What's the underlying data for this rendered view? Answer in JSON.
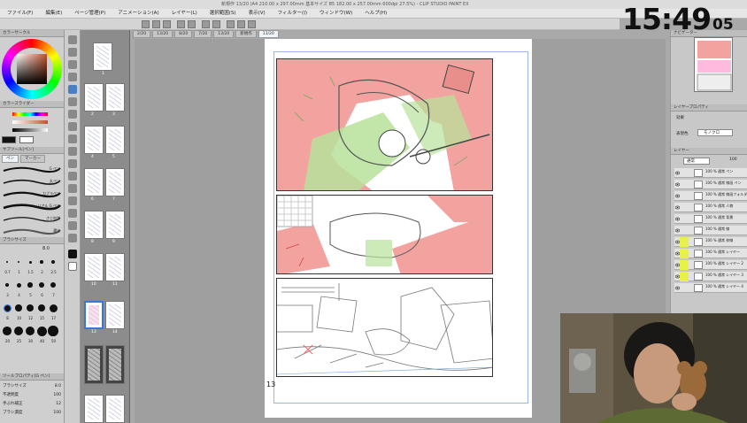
{
  "title_bar": {
    "text": "新規作 13/20 (A4 210.00 x 297.00mm 基本サイズ B5 182.00 x 257.00mm 600dpi 27.5%) - CLIP STUDIO PAINT EX"
  },
  "menu": [
    "ファイル(F)",
    "編集(E)",
    "ページ管理(P)",
    "アニメーション(A)",
    "レイヤー(L)",
    "選択範囲(S)",
    "表示(V)",
    "フィルター(I)",
    "ウィンドウ(W)",
    "ヘルプ(H)"
  ],
  "doc_tabs": [
    "2/20",
    "13/20",
    "8/20",
    "7/20",
    "13/20",
    "新規作",
    "13/20"
  ],
  "left_panel": {
    "color_header": "カラーサークル",
    "slider_header": "カラースライダー",
    "brush_header": "サブツール[ペン]",
    "brush_tab": "ペン",
    "brush_tab2": "マーカー",
    "brushes": [
      "G ペン",
      "丸ペン",
      "カブラペン",
      "リアル G ペン",
      "さじ加減",
      "濃淡"
    ],
    "size_header": "ブラシサイズ",
    "size_value": "8.0",
    "size_labels": [
      "0.7",
      "1",
      "1.5",
      "2",
      "2.5",
      "3",
      "4",
      "5",
      "6",
      "7",
      "8",
      "10",
      "12",
      "15",
      "17",
      "20",
      "25",
      "30",
      "40",
      "50"
    ],
    "tool_prop_header": "ツールプロパティ[G ペン]",
    "props": [
      "ブラシサイズ",
      "不透明度",
      "手ぶれ補正",
      "ブラシ濃度"
    ],
    "prop_values": [
      "8.0",
      "100",
      "12",
      "100"
    ]
  },
  "page_panel": {
    "pages": [
      "1",
      "2",
      "3",
      "4",
      "5",
      "6",
      "7",
      "8",
      "9",
      "10",
      "11",
      "12",
      "13",
      "14"
    ],
    "active": "13"
  },
  "canvas": {
    "page_number": "13"
  },
  "right_panel": {
    "nav_header": "ナビゲーター",
    "prop_header": "レイヤープロパティ",
    "prop_label": "効果",
    "color_label": "表現色",
    "color_value": "モノクロ",
    "layer_header": "レイヤー",
    "blend_mode": "通常",
    "opacity": "100",
    "layers": [
      {
        "name": "100 % 通常 ペン",
        "visible": true
      },
      {
        "name": "100 % 通常 線画 ペン",
        "visible": true
      },
      {
        "name": "100 % 通常 線画フォルダ",
        "visible": true
      },
      {
        "name": "100 % 通常 人物",
        "visible": true
      },
      {
        "name": "100 % 通常 背景",
        "visible": true
      },
      {
        "name": "100 % 通常 線",
        "visible": true
      },
      {
        "name": "100 % 通常 枠線",
        "visible": true
      },
      {
        "name": "100 % 通常 レイヤー",
        "visible": true
      },
      {
        "name": "100 % 通常 レイヤー 2",
        "visible": true
      },
      {
        "name": "100 % 通常 レイヤー 3",
        "visible": true
      },
      {
        "name": "100 % 通常 レイヤー 4",
        "visible": true
      }
    ]
  },
  "clock": {
    "hm": "15:49",
    "sec": "05"
  },
  "colors": {
    "accent_red": "#f2a3a0",
    "accent_green": "#b7e29a",
    "panel_bg": "#cfcfcf",
    "highlight": "#e7f14a"
  }
}
